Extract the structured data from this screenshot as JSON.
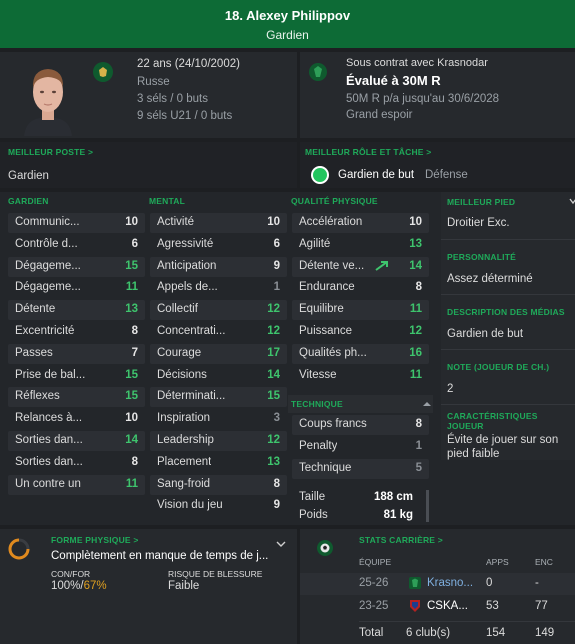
{
  "header": {
    "name": "18. Alexey Philippov",
    "position": "Gardien"
  },
  "profile": {
    "age": "22 ans (24/10/2002)",
    "nationality": "Russe",
    "caps": "3 séls / 0 buts",
    "u21_caps": "9 séls U21 / 0 buts"
  },
  "contract": {
    "status": "Sous contrat avec Krasnodar",
    "value": "Évalué à 30M R",
    "wage": "50M R p/a jusqu'au 30/6/2028",
    "potential": "Grand espoir"
  },
  "best_position": {
    "heading": "MEILLEUR POSTE >",
    "value": "Gardien"
  },
  "best_role": {
    "heading": "MEILLEUR RÔLE ET TÂCHE >",
    "role": "Gardien de but",
    "duty": "Défense"
  },
  "attributes": {
    "gk_heading": "GARDIEN",
    "mental_heading": "MENTAL",
    "physical_heading": "QUALITÉ PHYSIQUE",
    "technical_heading": "TECHNIQUE",
    "goalkeeping": [
      {
        "label": "Communic...",
        "value": "10",
        "tone": "w"
      },
      {
        "label": "Contrôle d...",
        "value": "6",
        "tone": "w"
      },
      {
        "label": "Dégageme...",
        "value": "15",
        "tone": "g"
      },
      {
        "label": "Dégageme...",
        "value": "11",
        "tone": "g"
      },
      {
        "label": "Détente",
        "value": "13",
        "tone": "g"
      },
      {
        "label": "Excentricité",
        "value": "8",
        "tone": "w"
      },
      {
        "label": "Passes",
        "value": "7",
        "tone": "w"
      },
      {
        "label": "Prise de bal...",
        "value": "15",
        "tone": "g"
      },
      {
        "label": "Réflexes",
        "value": "15",
        "tone": "g"
      },
      {
        "label": "Relances à...",
        "value": "10",
        "tone": "w"
      },
      {
        "label": "Sorties dan...",
        "value": "14",
        "tone": "g"
      },
      {
        "label": "Sorties dan...",
        "value": "8",
        "tone": "w"
      },
      {
        "label": "Un contre un",
        "value": "11",
        "tone": "g"
      }
    ],
    "mental": [
      {
        "label": "Activité",
        "value": "10",
        "tone": "w"
      },
      {
        "label": "Agressivité",
        "value": "6",
        "tone": "w"
      },
      {
        "label": "Anticipation",
        "value": "9",
        "tone": "w"
      },
      {
        "label": "Appels de...",
        "value": "1",
        "tone": "gr"
      },
      {
        "label": "Collectif",
        "value": "12",
        "tone": "g"
      },
      {
        "label": "Concentrati...",
        "value": "12",
        "tone": "g"
      },
      {
        "label": "Courage",
        "value": "17",
        "tone": "g"
      },
      {
        "label": "Décisions",
        "value": "14",
        "tone": "g"
      },
      {
        "label": "Déterminati...",
        "value": "15",
        "tone": "g"
      },
      {
        "label": "Inspiration",
        "value": "3",
        "tone": "gr"
      },
      {
        "label": "Leadership",
        "value": "12",
        "tone": "g"
      },
      {
        "label": "Placement",
        "value": "13",
        "tone": "g"
      },
      {
        "label": "Sang-froid",
        "value": "8",
        "tone": "w"
      },
      {
        "label": "Vision du jeu",
        "value": "9",
        "tone": "w"
      }
    ],
    "physical": [
      {
        "label": "Accélération",
        "value": "10",
        "tone": "w"
      },
      {
        "label": "Agilité",
        "value": "13",
        "tone": "g"
      },
      {
        "label": "Détente ve...",
        "value": "14",
        "tone": "g"
      },
      {
        "label": "Endurance",
        "value": "8",
        "tone": "w"
      },
      {
        "label": "Équilibre",
        "value": "11",
        "tone": "g"
      },
      {
        "label": "Puissance",
        "value": "12",
        "tone": "g"
      },
      {
        "label": "Qualités ph...",
        "value": "16",
        "tone": "g"
      },
      {
        "label": "Vitesse",
        "value": "11",
        "tone": "g"
      }
    ],
    "technical": [
      {
        "label": "Coups francs",
        "value": "8",
        "tone": "w"
      },
      {
        "label": "Penalty",
        "value": "1",
        "tone": "gr"
      },
      {
        "label": "Technique",
        "value": "5",
        "tone": "gr"
      }
    ],
    "height_label": "Taille",
    "height": "188 cm",
    "weight_label": "Poids",
    "weight": "81 kg"
  },
  "side": {
    "foot_h": "MEILLEUR PIED",
    "foot": "Droitier Exc.",
    "pers_h": "PERSONNALITÉ",
    "pers": "Assez déterminé",
    "media_h": "DESCRIPTION DES MÉDIAS",
    "media": "Gardien de but",
    "note_h": "NOTE (JOUEUR DE CH.)",
    "note": "2",
    "traits_h": "CARACTÉRISTIQUES JOUEUR",
    "traits": "Évite de jouer sur son pied faible"
  },
  "fitness": {
    "heading": "FORME PHYSIQUE >",
    "status": "Complètement en manque de temps de j...",
    "conf_label": "CON/FOR",
    "conf_a": "100%",
    "conf_sep": "/",
    "conf_b": "67%",
    "injury_label": "RISQUE DE BLESSURE",
    "injury": "Faible"
  },
  "career": {
    "heading": "STATS CARRIÈRE >",
    "cols": [
      "ÉQUIPE",
      "APPS",
      "ENC"
    ],
    "rows": [
      {
        "season": "25-26",
        "team": "Krasno...",
        "apps": "0",
        "enc": "-"
      },
      {
        "season": "23-25",
        "team": "CSKA...",
        "apps": "53",
        "enc": "77"
      }
    ],
    "total_label": "Total",
    "total_clubs": "6 club(s)",
    "total_apps": "154",
    "total_enc": "149"
  },
  "colors": {
    "accent": "#1faa5a",
    "header": "#0d6b36",
    "good": "#3ec46d",
    "low": "#8a8f95"
  }
}
